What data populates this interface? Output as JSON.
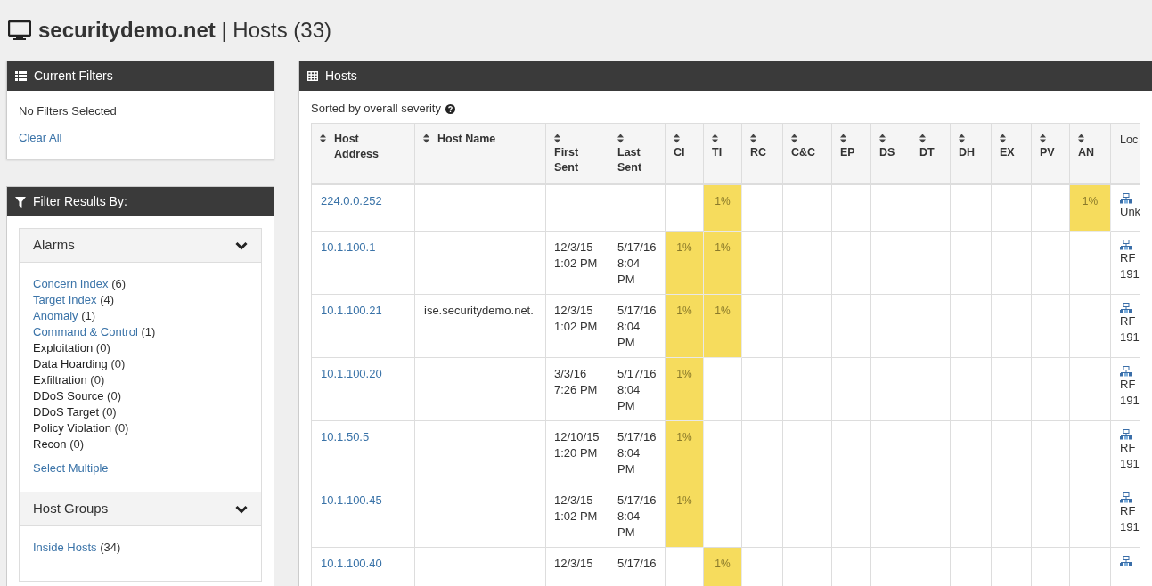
{
  "page_title": {
    "site": "securitydemo.net",
    "separator": "|",
    "section": "Hosts (33)"
  },
  "current_filters": {
    "title": "Current Filters",
    "status": "No Filters Selected",
    "clear_link": "Clear All"
  },
  "filter_panel": {
    "title": "Filter Results By:",
    "groups": [
      {
        "title": "Alarms",
        "expanded": true,
        "items": [
          {
            "label": "Concern Index",
            "count": "(6)",
            "enabled": true
          },
          {
            "label": "Target Index",
            "count": "(4)",
            "enabled": true
          },
          {
            "label": "Anomaly",
            "count": "(1)",
            "enabled": true
          },
          {
            "label": "Command & Control",
            "count": "(1)",
            "enabled": true
          },
          {
            "label": "Exploitation",
            "count": "(0)",
            "enabled": false
          },
          {
            "label": "Data Hoarding",
            "count": "(0)",
            "enabled": false
          },
          {
            "label": "Exfiltration",
            "count": "(0)",
            "enabled": false
          },
          {
            "label": "DDoS Source",
            "count": "(0)",
            "enabled": false
          },
          {
            "label": "DDoS Target",
            "count": "(0)",
            "enabled": false
          },
          {
            "label": "Policy Violation",
            "count": "(0)",
            "enabled": false
          },
          {
            "label": "Recon",
            "count": "(0)",
            "enabled": false
          }
        ],
        "footer_link": "Select Multiple"
      },
      {
        "title": "Host Groups",
        "expanded": true,
        "items": [
          {
            "label": "Inside Hosts",
            "count": "(34)",
            "enabled": true
          }
        ]
      }
    ]
  },
  "hosts_panel": {
    "title": "Hosts",
    "sort_note": "Sorted by overall severity",
    "columns": [
      "Host Address",
      "Host Name",
      "First Sent",
      "Last Sent",
      "CI",
      "TI",
      "RC",
      "C&C",
      "EP",
      "DS",
      "DT",
      "DH",
      "EX",
      "PV",
      "AN",
      "Loc"
    ],
    "rows": [
      {
        "address": "224.0.0.252",
        "scores": [
          {
            "highlighted": false
          },
          {
            "highlighted": true,
            "value": "1%"
          },
          {
            "highlighted": false
          },
          {
            "highlighted": false
          },
          {
            "highlighted": false
          },
          {
            "highlighted": false
          },
          {
            "highlighted": false
          },
          {
            "highlighted": false
          },
          {
            "highlighted": false
          },
          {
            "highlighted": false
          },
          {
            "highlighted": true,
            "value": "1%"
          }
        ],
        "location": [
          "Unk"
        ]
      },
      {
        "address": "10.1.100.1",
        "first_sent": [
          "12/3/15",
          "1:02 PM"
        ],
        "last_sent": [
          "5/17/16",
          "8:04",
          "PM"
        ],
        "scores": [
          {
            "highlighted": true,
            "value": "1%"
          },
          {
            "highlighted": true,
            "value": "1%"
          },
          {
            "highlighted": false
          },
          {
            "highlighted": false
          },
          {
            "highlighted": false
          },
          {
            "highlighted": false
          },
          {
            "highlighted": false
          },
          {
            "highlighted": false
          },
          {
            "highlighted": false
          },
          {
            "highlighted": false
          },
          {
            "highlighted": false
          }
        ],
        "location": [
          "RF",
          "191"
        ]
      },
      {
        "address": "10.1.100.21",
        "host_name": "ise.securitydemo.net.",
        "first_sent": [
          "12/3/15",
          "1:02 PM"
        ],
        "last_sent": [
          "5/17/16",
          "8:04",
          "PM"
        ],
        "scores": [
          {
            "highlighted": true,
            "value": "1%"
          },
          {
            "highlighted": true,
            "value": "1%"
          },
          {
            "highlighted": false
          },
          {
            "highlighted": false
          },
          {
            "highlighted": false
          },
          {
            "highlighted": false
          },
          {
            "highlighted": false
          },
          {
            "highlighted": false
          },
          {
            "highlighted": false
          },
          {
            "highlighted": false
          },
          {
            "highlighted": false
          }
        ],
        "location": [
          "RF",
          "191"
        ]
      },
      {
        "address": "10.1.100.20",
        "first_sent": [
          "3/3/16",
          "7:26 PM"
        ],
        "last_sent": [
          "5/17/16",
          "8:04",
          "PM"
        ],
        "scores": [
          {
            "highlighted": true,
            "value": "1%"
          },
          {
            "highlighted": false
          },
          {
            "highlighted": false
          },
          {
            "highlighted": false
          },
          {
            "highlighted": false
          },
          {
            "highlighted": false
          },
          {
            "highlighted": false
          },
          {
            "highlighted": false
          },
          {
            "highlighted": false
          },
          {
            "highlighted": false
          },
          {
            "highlighted": false
          }
        ],
        "location": [
          "RF",
          "191"
        ]
      },
      {
        "address": "10.1.50.5",
        "first_sent": [
          "12/10/15",
          "1:20 PM"
        ],
        "last_sent": [
          "5/17/16",
          "8:04",
          "PM"
        ],
        "scores": [
          {
            "highlighted": true,
            "value": "1%"
          },
          {
            "highlighted": false
          },
          {
            "highlighted": false
          },
          {
            "highlighted": false
          },
          {
            "highlighted": false
          },
          {
            "highlighted": false
          },
          {
            "highlighted": false
          },
          {
            "highlighted": false
          },
          {
            "highlighted": false
          },
          {
            "highlighted": false
          },
          {
            "highlighted": false
          }
        ],
        "location": [
          "RF",
          "191"
        ]
      },
      {
        "address": "10.1.100.45",
        "first_sent": [
          "12/3/15",
          "1:02 PM"
        ],
        "last_sent": [
          "5/17/16",
          "8:04",
          "PM"
        ],
        "scores": [
          {
            "highlighted": true,
            "value": "1%"
          },
          {
            "highlighted": false
          },
          {
            "highlighted": false
          },
          {
            "highlighted": false
          },
          {
            "highlighted": false
          },
          {
            "highlighted": false
          },
          {
            "highlighted": false
          },
          {
            "highlighted": false
          },
          {
            "highlighted": false
          },
          {
            "highlighted": false
          },
          {
            "highlighted": false
          }
        ],
        "location": [
          "RF",
          "191"
        ]
      },
      {
        "address": "10.1.100.40",
        "first_sent": [
          "12/3/15"
        ],
        "last_sent": [
          "5/17/16"
        ],
        "scores": [
          {
            "highlighted": false
          },
          {
            "highlighted": true,
            "value": "1%"
          },
          {
            "highlighted": false
          },
          {
            "highlighted": false
          },
          {
            "highlighted": false
          },
          {
            "highlighted": false
          },
          {
            "highlighted": false
          },
          {
            "highlighted": false
          },
          {
            "highlighted": false
          },
          {
            "highlighted": false
          },
          {
            "highlighted": false
          }
        ]
      }
    ]
  }
}
